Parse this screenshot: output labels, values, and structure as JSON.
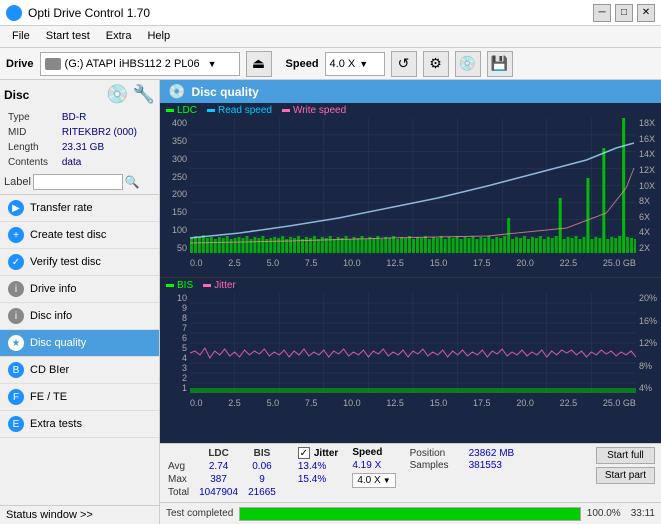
{
  "titleBar": {
    "title": "Opti Drive Control 1.70",
    "minimize": "─",
    "maximize": "□",
    "close": "✕"
  },
  "menu": {
    "items": [
      "File",
      "Start test",
      "Extra",
      "Help"
    ]
  },
  "toolbar": {
    "driveLabel": "Drive",
    "driveName": "(G:) ATAPI iHBS112  2 PL06",
    "speedLabel": "Speed",
    "speedValue": "4.0 X"
  },
  "disc": {
    "header": "Disc",
    "typeLabel": "Type",
    "typeValue": "BD-R",
    "midLabel": "MID",
    "midValue": "RITEKBR2 (000)",
    "lengthLabel": "Length",
    "lengthValue": "23.31 GB",
    "contentsLabel": "Contents",
    "contentsValue": "data",
    "labelLabel": "Label"
  },
  "nav": {
    "items": [
      {
        "id": "transfer-rate",
        "label": "Transfer rate",
        "active": false
      },
      {
        "id": "create-test-disc",
        "label": "Create test disc",
        "active": false
      },
      {
        "id": "verify-test-disc",
        "label": "Verify test disc",
        "active": false
      },
      {
        "id": "drive-info",
        "label": "Drive info",
        "active": false
      },
      {
        "id": "disc-info",
        "label": "Disc info",
        "active": false
      },
      {
        "id": "disc-quality",
        "label": "Disc quality",
        "active": true
      },
      {
        "id": "cd-bier",
        "label": "CD BIer",
        "active": false
      },
      {
        "id": "fe-te",
        "label": "FE / TE",
        "active": false
      },
      {
        "id": "extra-tests",
        "label": "Extra tests",
        "active": false
      }
    ]
  },
  "statusWindow": {
    "label": "Status window >>",
    "statusText": "Test completed"
  },
  "discQuality": {
    "title": "Disc quality"
  },
  "legend": {
    "top": [
      {
        "label": "LDC",
        "color": "#00ff00"
      },
      {
        "label": "Read speed",
        "color": "#00ccff"
      },
      {
        "label": "Write speed",
        "color": "#ff69b4"
      }
    ],
    "bottom": [
      {
        "label": "BIS",
        "color": "#00ff00"
      },
      {
        "label": "Jitter",
        "color": "#ff69b4"
      }
    ]
  },
  "chartTop": {
    "yLabels": [
      "400",
      "350",
      "300",
      "250",
      "200",
      "150",
      "100",
      "50"
    ],
    "yLabelsRight": [
      "18X",
      "16X",
      "14X",
      "12X",
      "10X",
      "8X",
      "6X",
      "4X",
      "2X"
    ],
    "xLabels": [
      "0.0",
      "2.5",
      "5.0",
      "7.5",
      "10.0",
      "12.5",
      "15.0",
      "17.5",
      "20.0",
      "22.5",
      "25.0 GB"
    ]
  },
  "chartBottom": {
    "yLabels": [
      "10",
      "9",
      "8",
      "7",
      "6",
      "5",
      "4",
      "3",
      "2",
      "1"
    ],
    "yLabelsRight": [
      "20%",
      "16%",
      "12%",
      "8%",
      "4%"
    ],
    "xLabels": [
      "0.0",
      "2.5",
      "5.0",
      "7.5",
      "10.0",
      "12.5",
      "15.0",
      "17.5",
      "20.0",
      "22.5",
      "25.0 GB"
    ]
  },
  "stats": {
    "columns": [
      "LDC",
      "BIS",
      "",
      "Jitter",
      "Speed"
    ],
    "rows": [
      {
        "label": "Avg",
        "ldc": "2.74",
        "bis": "0.06",
        "jitter": "13.4%",
        "speed": "4.19 X"
      },
      {
        "label": "Max",
        "ldc": "387",
        "bis": "9",
        "jitter": "15.4%"
      },
      {
        "label": "Total",
        "ldc": "1047904",
        "bis": "21665"
      }
    ],
    "speedDropdown": "4.0 X",
    "jitterLabel": "Jitter",
    "positionLabel": "Position",
    "positionValue": "23862 MB",
    "samplesLabel": "Samples",
    "samplesValue": "381553"
  },
  "buttons": {
    "startFull": "Start full",
    "startPart": "Start part"
  },
  "progress": {
    "percentage": "100.0%",
    "time": "33:11",
    "barWidth": 100
  }
}
